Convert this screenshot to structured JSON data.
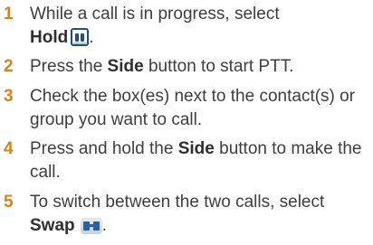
{
  "steps": [
    {
      "number": "1",
      "line1": "While a call is in progress, select",
      "bold": "Hold",
      "icon": "hold-pause-icon"
    },
    {
      "number": "2",
      "before": "Press the ",
      "bold": "Side",
      "after": " button to start PTT."
    },
    {
      "number": "3",
      "text": "Check the box(es) next to the contact(s) or group you want to call."
    },
    {
      "number": "4",
      "before": "Press and hold the ",
      "bold": "Side",
      "after": " button to make the call."
    },
    {
      "number": "5",
      "line1": "To switch between the two calls, select",
      "bold": "Swap",
      "icon": "swap-calls-icon"
    }
  ],
  "colors": {
    "number": "#d2831e",
    "text": "#3d3d3d",
    "icon": "#1f4f86"
  }
}
